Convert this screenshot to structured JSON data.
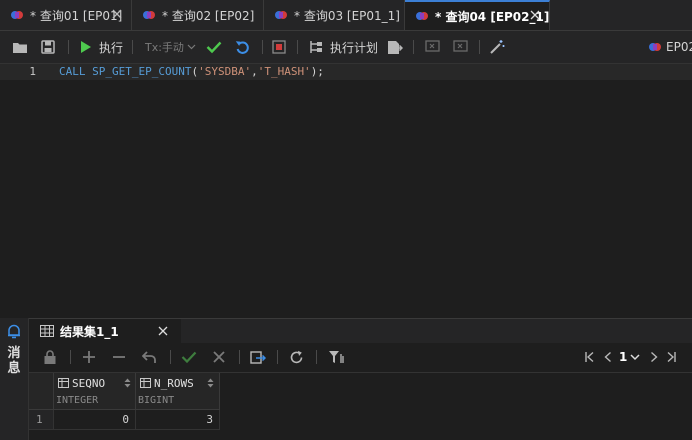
{
  "tabs": [
    {
      "label": "* 查询01 [EP01]",
      "active": false
    },
    {
      "label": "* 查询02 [EP02]",
      "active": false
    },
    {
      "label": "* 查询03 [EP01_1]",
      "active": false
    },
    {
      "label": "* 查询04 [EP02_1]",
      "active": true
    }
  ],
  "toolbar": {
    "execute_label": "执行",
    "tx_mode_label": "Tx:手动",
    "plan_label": "执行计划",
    "connection_label": "EP02"
  },
  "editor": {
    "line_number": "1",
    "tokens": {
      "call": "CALL",
      "proc": "SP_GET_EP_COUNT",
      "open": "(",
      "arg1": "'SYSDBA'",
      "comma": ",",
      "arg2": "'T_HASH'",
      "close": ");"
    }
  },
  "side_panel": {
    "messages_label": "消息"
  },
  "result": {
    "tab_label": "结果集1_1",
    "page_number": "1",
    "columns": [
      {
        "name": "SEQNO",
        "type": "INTEGER"
      },
      {
        "name": "N_ROWS",
        "type": "BIGINT"
      }
    ],
    "rows": [
      {
        "row_number": "1",
        "cells": [
          "0",
          "3"
        ]
      }
    ]
  },
  "colors": {
    "accent": "#3c7fd4",
    "keyword": "#569cd6",
    "string": "#ce9178",
    "ok_green": "#4ec94e"
  },
  "icons": [
    "database-icon",
    "close-icon",
    "folder-icon",
    "save-icon",
    "play-icon",
    "check-icon",
    "undo-icon",
    "stop-icon",
    "plan-icon",
    "export-icon",
    "magic-wand-icon",
    "bell-icon",
    "table-icon",
    "lock-icon",
    "plus-icon",
    "minus-icon",
    "reply-icon",
    "x-icon",
    "refresh-icon",
    "filter-icon",
    "first-page-icon",
    "prev-page-icon",
    "next-page-icon",
    "last-page-icon",
    "sort-icon"
  ]
}
